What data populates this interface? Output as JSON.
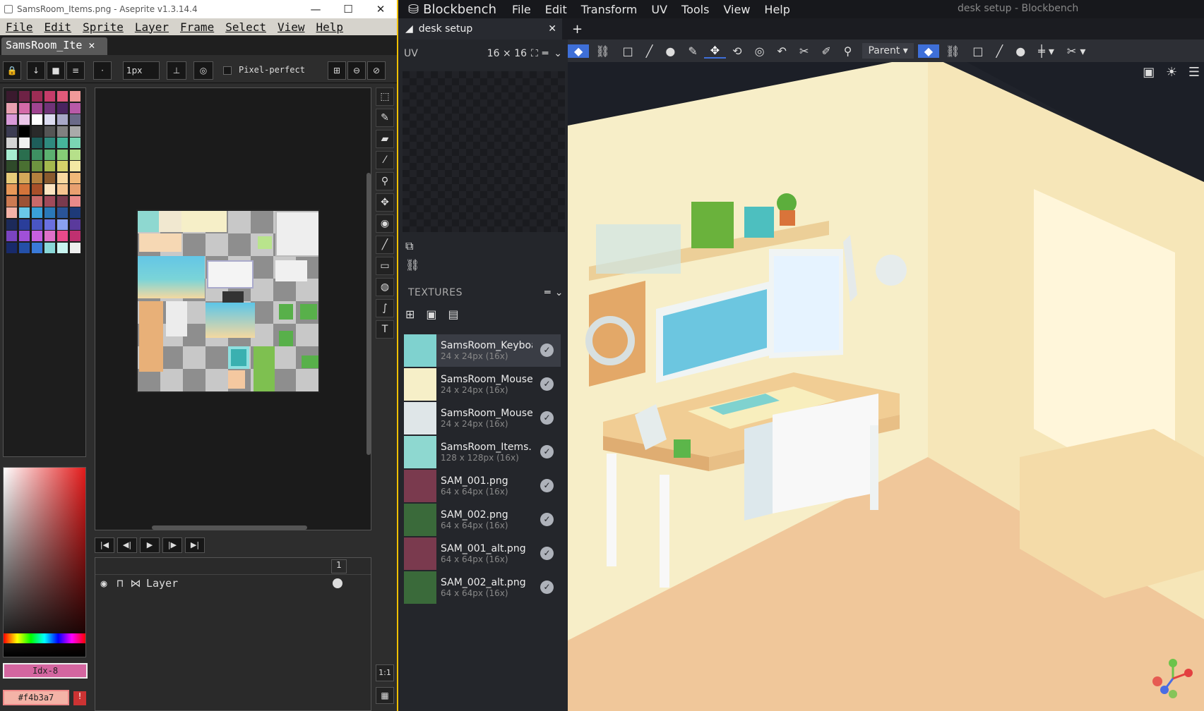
{
  "aseprite": {
    "title": "SamsRoom_Items.png - Aseprite v1.3.14.4",
    "menu": [
      "File",
      "Edit",
      "Sprite",
      "Layer",
      "Frame",
      "Select",
      "View",
      "Help"
    ],
    "tab": "SamsRoom_Ite",
    "brush_size": "1px",
    "pixel_perfect": "Pixel-perfect",
    "layer_name": "Layer",
    "frame_number": "1",
    "idx_label": "Idx-8",
    "hex_label": "#f4b3a7",
    "zoom_label": "1:1"
  },
  "blockbench": {
    "app": "Blockbench",
    "menu": [
      "File",
      "Edit",
      "Transform",
      "UV",
      "Tools",
      "View",
      "Help"
    ],
    "window_title": "desk setup - Blockbench",
    "tab": "desk setup",
    "uv_label": "UV",
    "uv_size": "16 × 16",
    "textures_label": "TEXTURES",
    "pivot_mode": "Parent",
    "textures": [
      {
        "name": "SamsRoom_Keyboa",
        "size": "24 x 24px (16x)"
      },
      {
        "name": "SamsRoom_Mousep",
        "size": "24 x 24px (16x)"
      },
      {
        "name": "SamsRoom_Mouse.",
        "size": "24 x 24px (16x)"
      },
      {
        "name": "SamsRoom_Items.p",
        "size": "128 x 128px (16x)"
      },
      {
        "name": "SAM_001.png",
        "size": "64 x 64px (16x)"
      },
      {
        "name": "SAM_002.png",
        "size": "64 x 64px (16x)"
      },
      {
        "name": "SAM_001_alt.png",
        "size": "64 x 64px (16x)"
      },
      {
        "name": "SAM_002_alt.png",
        "size": "64 x 64px (16x)"
      }
    ]
  },
  "colors": {
    "accent": "#3e6fd8",
    "fg_color": "#f4b3a7",
    "idx_color": "#d466a0",
    "frame_yellow": "#f0c000"
  }
}
